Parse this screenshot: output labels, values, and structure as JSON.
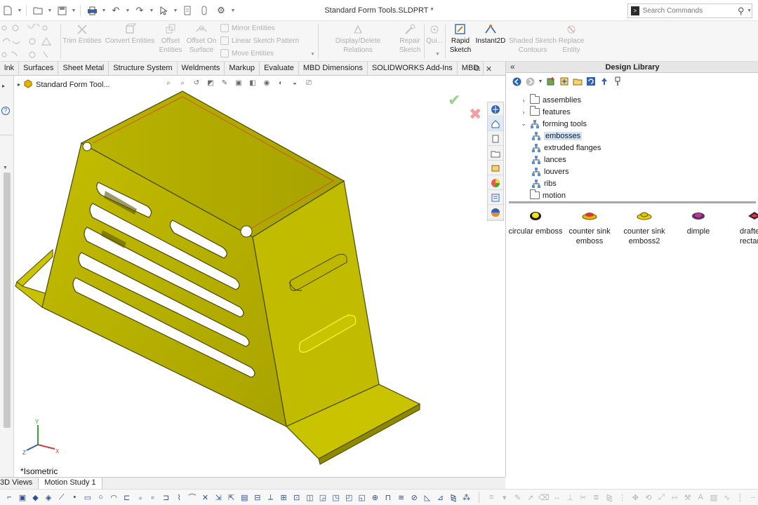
{
  "window": {
    "title": "Standard Form Tools.SLDPRT *"
  },
  "search": {
    "placeholder": "Search Commands"
  },
  "command_manager": {
    "tools": [
      {
        "label_1": "Trim Entities",
        "label_2": "",
        "enabled": false
      },
      {
        "label_1": "Convert Entities",
        "label_2": "",
        "enabled": false
      },
      {
        "label_1": "Offset",
        "label_2": "Entities",
        "enabled": false
      },
      {
        "label_1": "Offset On",
        "label_2": "Surface",
        "enabled": false
      },
      {
        "label_1": "Display/Delete Relations",
        "label_2": "",
        "enabled": false
      },
      {
        "label_1": "Repair",
        "label_2": "Sketch",
        "enabled": false
      },
      {
        "label_1": "Qui...",
        "label_2": "",
        "enabled": false
      },
      {
        "label_1": "Rapid",
        "label_2": "Sketch",
        "enabled": true
      },
      {
        "label_1": "Instant2D",
        "label_2": "",
        "enabled": true
      },
      {
        "label_1": "Shaded Sketch",
        "label_2": "Contours",
        "enabled": false
      },
      {
        "label_1": "Replace",
        "label_2": "Entity",
        "enabled": false
      }
    ],
    "pattern_group": [
      "Mirror Entities",
      "Linear Sketch Pattern",
      "Move Entities"
    ]
  },
  "tabs": [
    "lnk",
    "Surfaces",
    "Sheet Metal",
    "Structure System",
    "Weldments",
    "Markup",
    "Evaluate",
    "MBD Dimensions",
    "SOLIDWORKS Add-Ins",
    "MBD"
  ],
  "feature_tree": {
    "part_name": "Standard Form Tool..."
  },
  "viewport": {
    "view_label": "*Isometric",
    "triad": {
      "x": "X",
      "y": "Y",
      "z": "Z"
    },
    "ok_symbol": "✔",
    "cancel_symbol": "✖"
  },
  "design_library": {
    "title": "Design Library",
    "collapse_symbol": "«",
    "tree": [
      {
        "label": "assemblies",
        "level": 0,
        "expanded": false,
        "type": "folder"
      },
      {
        "label": "features",
        "level": 0,
        "expanded": false,
        "type": "folder"
      },
      {
        "label": "forming tools",
        "level": 0,
        "expanded": true,
        "type": "network"
      },
      {
        "label": "embosses",
        "level": 1,
        "selected": true,
        "type": "network"
      },
      {
        "label": "extruded flanges",
        "level": 1,
        "type": "network"
      },
      {
        "label": "lances",
        "level": 1,
        "type": "network"
      },
      {
        "label": "louvers",
        "level": 1,
        "type": "network"
      },
      {
        "label": "ribs",
        "level": 1,
        "type": "network"
      },
      {
        "label": "motion",
        "level": 0,
        "expanded": false,
        "type": "folder"
      }
    ],
    "items": [
      {
        "label_1": "circular emboss",
        "label_2": "",
        "thumb": "circular-emboss-thumb"
      },
      {
        "label_1": "counter sink",
        "label_2": "emboss",
        "thumb": "counter-sink-emboss-thumb"
      },
      {
        "label_1": "counter sink",
        "label_2": "emboss2",
        "thumb": "counter-sink-emboss2-thumb"
      },
      {
        "label_1": "dimple",
        "label_2": "",
        "thumb": "dimple-thumb"
      },
      {
        "label_1": "drafte",
        "label_2": "rectang",
        "thumb": "drafted-rectangle-thumb"
      }
    ]
  },
  "bottom_tabs": [
    "3D Views",
    "Motion Study 1"
  ],
  "colors": {
    "part_face": "#b9b400",
    "part_edge": "#4a4800",
    "accent_blue": "#2f62b5"
  }
}
